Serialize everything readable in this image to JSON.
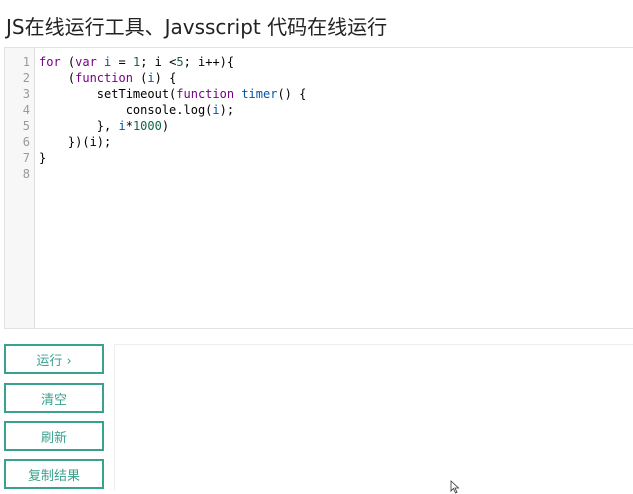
{
  "page": {
    "title": "JS在线运行工具、Javsscript 代码在线运行"
  },
  "editor": {
    "line_numbers": [
      "1",
      "2",
      "3",
      "4",
      "5",
      "6",
      "7",
      "8"
    ],
    "lines": [
      [
        {
          "t": "for ",
          "c": "kw"
        },
        {
          "t": "(",
          "c": "pl"
        },
        {
          "t": "var ",
          "c": "kw"
        },
        {
          "t": "i",
          "c": "vr"
        },
        {
          "t": " = ",
          "c": "pl"
        },
        {
          "t": "1",
          "c": "nm"
        },
        {
          "t": "; i <",
          "c": "pl"
        },
        {
          "t": "5",
          "c": "nm"
        },
        {
          "t": "; i++){",
          "c": "pl"
        }
      ],
      [
        {
          "t": "    (",
          "c": "pl"
        },
        {
          "t": "function ",
          "c": "kw"
        },
        {
          "t": "(",
          "c": "pl"
        },
        {
          "t": "i",
          "c": "vr"
        },
        {
          "t": ") {",
          "c": "pl"
        }
      ],
      [
        {
          "t": "        setTimeout(",
          "c": "pl"
        },
        {
          "t": "function ",
          "c": "kw"
        },
        {
          "t": "timer",
          "c": "vr"
        },
        {
          "t": "() {",
          "c": "pl"
        }
      ],
      [
        {
          "t": "            console.log(",
          "c": "pl"
        },
        {
          "t": "i",
          "c": "vr"
        },
        {
          "t": ");",
          "c": "pl"
        }
      ],
      [
        {
          "t": "        }, ",
          "c": "pl"
        },
        {
          "t": "i",
          "c": "vr"
        },
        {
          "t": "*",
          "c": "pl"
        },
        {
          "t": "1000",
          "c": "nm"
        },
        {
          "t": ")",
          "c": "pl"
        }
      ],
      [
        {
          "t": "    })(i);",
          "c": "pl"
        }
      ],
      [
        {
          "t": "}",
          "c": "pl"
        }
      ],
      [
        {
          "t": "",
          "c": "pl"
        }
      ]
    ]
  },
  "buttons": {
    "run": "运行 ›",
    "clear": "清空",
    "refresh": "刷新",
    "copy_result": "复制结果"
  },
  "output": {
    "text": ""
  },
  "colors": {
    "accent": "#3aa18e",
    "keyword": "#770088",
    "variable": "#0055aa",
    "number": "#116644"
  }
}
